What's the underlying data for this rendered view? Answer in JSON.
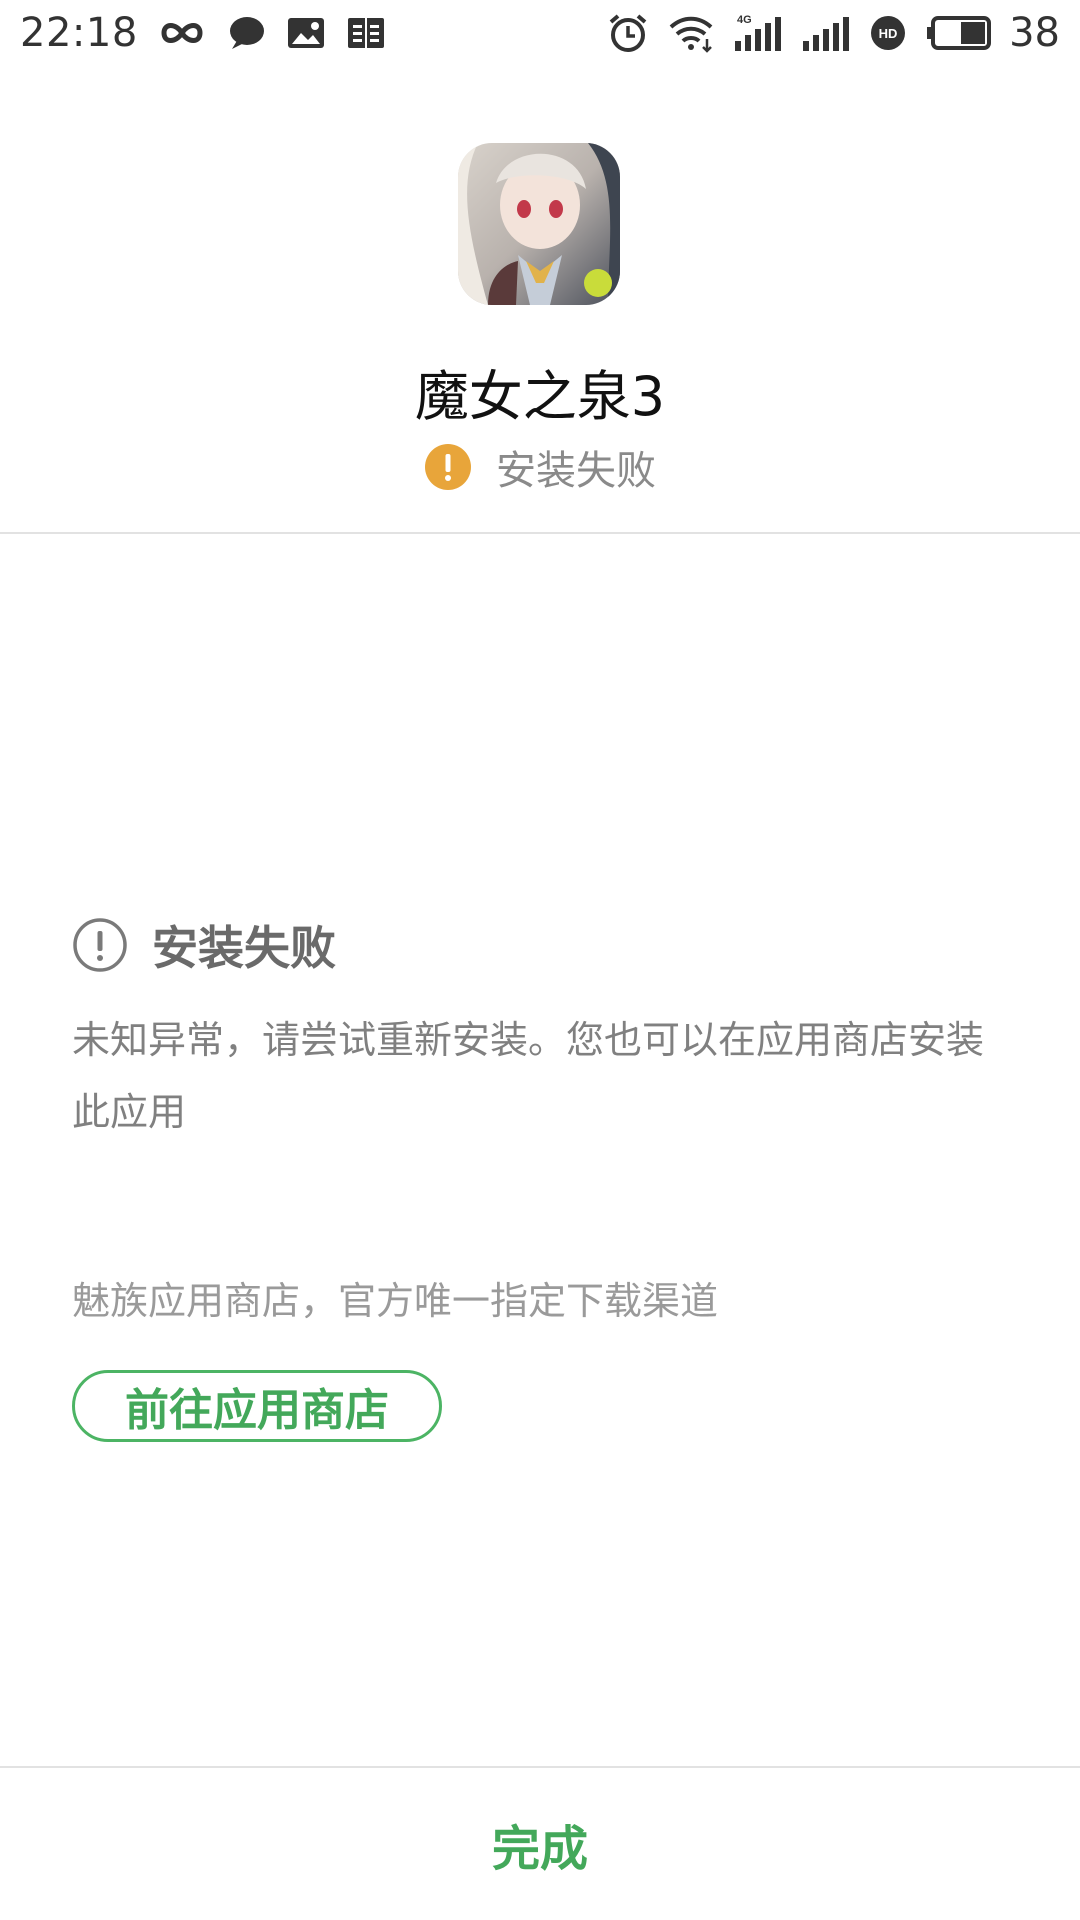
{
  "status_bar": {
    "time": "22:18",
    "battery_level": "38",
    "left_icons": [
      "infinity-icon",
      "chat-bubble-icon",
      "image-icon",
      "reader-icon"
    ],
    "right_icons": [
      "alarm-icon",
      "wifi-icon",
      "signal-4g-icon",
      "signal-icon",
      "hd-icon",
      "battery-icon"
    ],
    "network_label": "4G",
    "hd_label": "HD"
  },
  "app": {
    "name": "魔女之泉3",
    "status": "安装失败",
    "status_icon": "warning-icon",
    "status_color": "#e8a53a"
  },
  "failure": {
    "title": "安装失败",
    "title_icon": "alert-circle-icon",
    "message": "未知异常，请尝试重新安装。您也可以在应用商店安装此应用"
  },
  "store": {
    "note": "魅族应用商店，官方唯一指定下载渠道",
    "button_label": "前往应用商店"
  },
  "footer": {
    "done_label": "完成"
  },
  "colors": {
    "accent_green": "#43a85a",
    "warning_orange": "#e8a53a"
  }
}
